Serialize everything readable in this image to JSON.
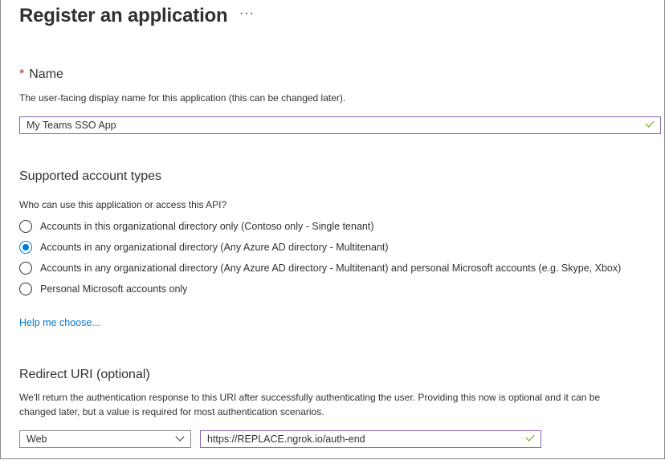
{
  "header": {
    "title": "Register an application",
    "more_label": "···"
  },
  "name_section": {
    "required_marker": "*",
    "title": "Name",
    "description": "The user-facing display name for this application (this can be changed later).",
    "value": "My Teams SSO App"
  },
  "account_types": {
    "title": "Supported account types",
    "question": "Who can use this application or access this API?",
    "options": [
      {
        "label": "Accounts in this organizational directory only (Contoso only - Single tenant)",
        "selected": false
      },
      {
        "label": "Accounts in any organizational directory (Any Azure AD directory - Multitenant)",
        "selected": true
      },
      {
        "label": "Accounts in any organizational directory (Any Azure AD directory - Multitenant) and personal Microsoft accounts (e.g. Skype, Xbox)",
        "selected": false
      },
      {
        "label": "Personal Microsoft accounts only",
        "selected": false
      }
    ],
    "help_link": "Help me choose..."
  },
  "redirect": {
    "title": "Redirect URI (optional)",
    "description_line1": "We'll return the authentication response to this URI after successfully authenticating the user. Providing this now is optional and it can be",
    "description_line2": "changed later, but a value is required for most authentication scenarios.",
    "platform_value": "Web",
    "uri_value": "https://REPLACE.ngrok.io/auth-end"
  },
  "colors": {
    "accent": "#0078d4",
    "valid": "#57a300",
    "focus_border": "#8764b8",
    "required": "#a4262c"
  }
}
